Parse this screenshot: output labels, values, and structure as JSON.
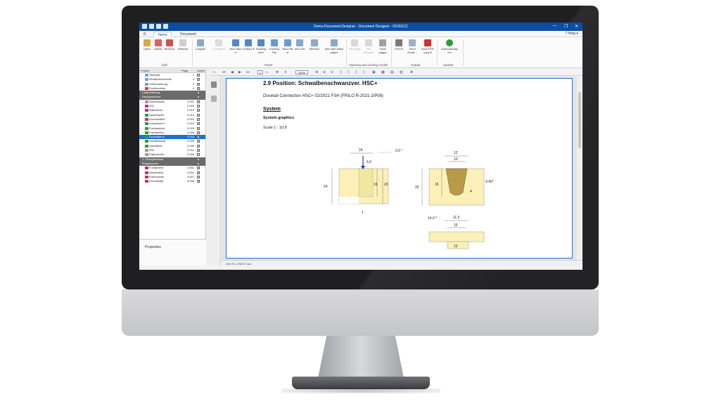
{
  "window": {
    "title": "Demo-Document.Designer - Document Designer - 02/2021C",
    "controls": [
      "—",
      "❐",
      "✕"
    ]
  },
  "tabs": [
    {
      "label": "Items",
      "active": true
    },
    {
      "label": "Document",
      "active": false
    }
  ],
  "help_label": "? Help ▾",
  "ribbon": {
    "edit": {
      "group": "Edit",
      "buttons": [
        "Open",
        "Delete",
        "Remove",
        "Refresh"
      ]
    },
    "paste": {
      "group": "Paste",
      "buttons": [
        "Chapter",
        "Comment",
        "New Item ▾",
        "Toolbox ▾",
        "Existing Item",
        "Existing File",
        "New File ▾",
        "Item list",
        "Member",
        "Item with blank pages"
      ]
    },
    "credits": {
      "group": "Opening and closing credits",
      "buttons": [
        "Title page",
        "Pre remarks",
        "Final pages"
      ]
    },
    "output": {
      "group": "Output",
      "buttons": [
        "Print ▾",
        "Send Email...",
        "Save PDF copy ▾"
      ]
    },
    "update": {
      "group": "Update",
      "buttons": [
        "Automatically On"
      ]
    }
  },
  "tree": {
    "headers": [
      "Project",
      "Page",
      "Active"
    ],
    "rows": [
      {
        "name": "Titelblatt",
        "page": "1",
        "type": "item",
        "color": "#7aa0d0",
        "checked": true
      },
      {
        "name": "Inhaltsverzeichnis",
        "page": "2",
        "type": "item",
        "color": "#7aa0d0",
        "checked": true
      },
      {
        "name": "Vorbemerkung",
        "page": "3",
        "type": "item",
        "color": "#7aa0d0",
        "checked": true
      },
      {
        "name": "Positionsliste",
        "page": "4",
        "type": "item",
        "color": "#d04040",
        "checked": true
      },
      {
        "name": "Lastermittlung",
        "page": "",
        "type": "group",
        "color": "",
        "checked": true
      },
      {
        "name": "Dachgeschoss",
        "page": "",
        "type": "group",
        "color": "",
        "checked": true
      },
      {
        "name": "Dachlübersc",
        "page": "2-001",
        "type": "item",
        "color": "#9a9a9a",
        "checked": true
      },
      {
        "name": "200",
        "page": "2-002",
        "type": "item",
        "color": "#c03070",
        "checked": true
      },
      {
        "name": "Stabwerke",
        "page": "2-015",
        "type": "item",
        "color": "#c03070",
        "checked": true
      },
      {
        "name": "Sparrenpfet",
        "page": "2-019",
        "type": "item",
        "color": "#2e9a3a",
        "checked": true
      },
      {
        "name": "Durchlaufträ",
        "page": "2-022",
        "type": "item",
        "color": "#c03070",
        "checked": true
      },
      {
        "name": "Anschluss H",
        "page": "2-024",
        "type": "item",
        "color": "#2e9a3a",
        "checked": true
      },
      {
        "name": "Fachwerkträ",
        "page": "2-025",
        "type": "item",
        "color": "#2e9a3a",
        "checked": true
      },
      {
        "name": "Fachwerkkn",
        "page": "2-028",
        "type": "item",
        "color": "#2e9a3a",
        "checked": true
      },
      {
        "name": "Schwalbens",
        "page": "2-034",
        "type": "selected",
        "color": "#2e9a3a",
        "checked": true
      },
      {
        "name": "Holzflächend",
        "page": "2-035",
        "type": "item",
        "color": "#2e9a3a",
        "checked": true
      },
      {
        "name": "Holzstütze",
        "page": "2-039",
        "type": "item",
        "color": "#2e9a3a",
        "checked": true
      },
      {
        "name": "306",
        "page": "2-041",
        "type": "item",
        "color": "#9a9a9a",
        "checked": true
      },
      {
        "name": "Ergänzende",
        "page": "2-046",
        "type": "item",
        "color": "#9a9a9a",
        "checked": true
      },
      {
        "name": "1. Obergeschoss",
        "page": "",
        "type": "group",
        "color": "",
        "checked": true
      },
      {
        "name": "Erdgeschoss",
        "page": "",
        "type": "group",
        "color": "",
        "checked": true
      },
      {
        "name": "Fundament",
        "page": "4-001",
        "type": "item",
        "color": "#c03070",
        "checked": true
      },
      {
        "name": "Winkelstütz",
        "page": "4-004",
        "type": "item",
        "color": "#c03070",
        "checked": true
      },
      {
        "name": "Erddruckwe",
        "page": "4-007",
        "type": "item",
        "color": "#c03070",
        "checked": true
      },
      {
        "name": "Durchlaufpl",
        "page": "4-008",
        "type": "item",
        "color": "#c03070",
        "checked": true
      }
    ]
  },
  "properties_title": "Properties",
  "preview": {
    "page_current": "1",
    "page_total": "/ 1",
    "zoom": "150%",
    "status": "209.79 x 296.97 mm"
  },
  "document": {
    "title": "2.9 Position: Schwalbenschwanzver.  HSC+",
    "subtitle": "Dovetail Connection HSC+ 02/2021 FSH (FRILO R-2021-2/P06)",
    "heading": "System",
    "subheading": "System graphics",
    "scale": "Scale 1 : 10.8",
    "dims": {
      "a": "16",
      "angle": "0.0 °",
      "load": "5.0",
      "h1": "24",
      "h2": "16",
      "h3": "20",
      "b": "1",
      "w1": "12",
      "w2": "10",
      "v1": "20",
      "v2": "16",
      "slope": "9.40°",
      "c1": "4",
      "ang2": "14.0 °",
      "w3": "11.5",
      "w4": "10",
      "w5": "12"
    }
  }
}
